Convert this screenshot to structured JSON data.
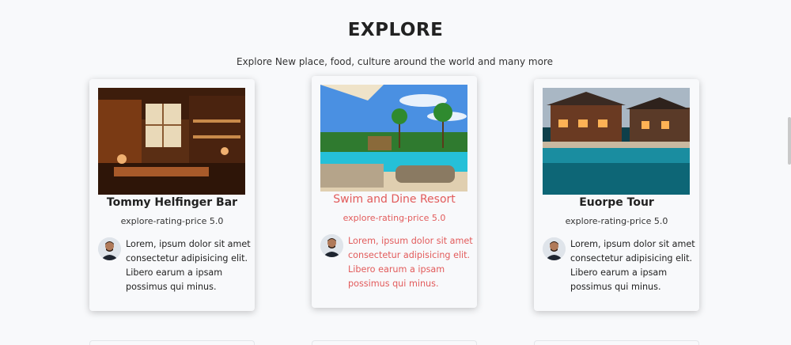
{
  "section": {
    "title": "EXPLORE",
    "subtitle": "Explore New place, food, culture around the world and many more"
  },
  "cards": [
    {
      "title": "Tommy Helfinger Bar",
      "rating": "explore-rating-price 5.0",
      "description": "Lorem, ipsum dolor sit amet consectetur adipisicing elit. Libero earum a ipsam possimus qui minus.",
      "image_icon": "bar-interior-image",
      "highlighted": false
    },
    {
      "title": "Swim and Dine Resort",
      "rating": "explore-rating-price 5.0",
      "description": "Lorem, ipsum dolor sit amet consectetur adipisicing elit. Libero earum a ipsam possimus qui minus.",
      "image_icon": "resort-pool-image",
      "highlighted": true
    },
    {
      "title": "Euorpe Tour",
      "rating": "explore-rating-price 5.0",
      "description": "Lorem, ipsum dolor sit amet consectetur adipisicing elit. Libero earum a ipsam possimus qui minus.",
      "image_icon": "villa-pool-image",
      "highlighted": false
    }
  ],
  "colors": {
    "background": "#f8f9fb",
    "highlight_text": "#e25b5b",
    "text": "#212529"
  }
}
